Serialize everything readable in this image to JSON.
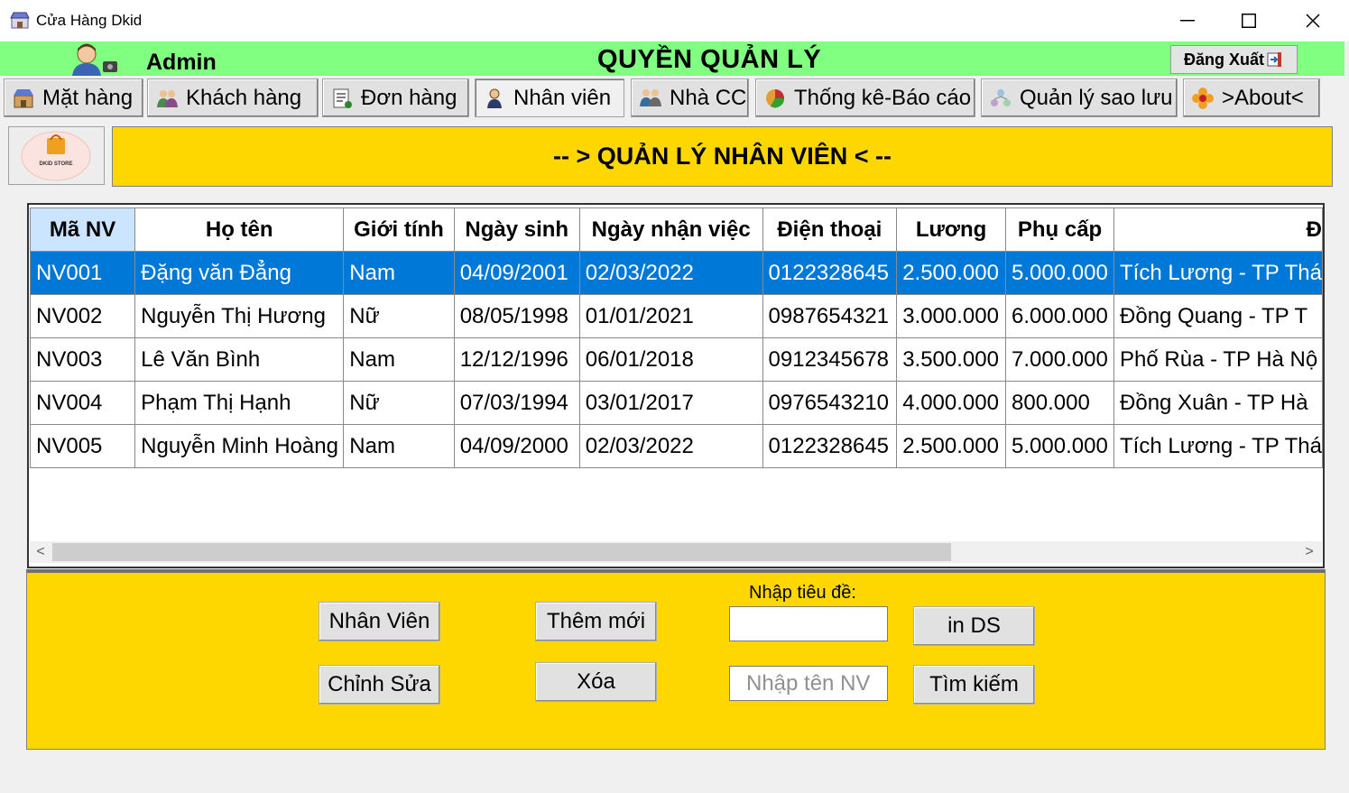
{
  "window": {
    "title": "Cửa Hàng Dkid",
    "minimize_glyph": "—",
    "maximize_glyph": "☐",
    "close_glyph": "✕"
  },
  "header": {
    "user_label": "Admin",
    "role_title": "QUYỀN QUẢN LÝ",
    "logout_label": "Đăng Xuất",
    "bg_color": "#80ff80"
  },
  "tabs": [
    {
      "label": "Mặt hàng",
      "icon": "store-icon"
    },
    {
      "label": "Khách hàng",
      "icon": "customers-icon"
    },
    {
      "label": "Đơn hàng",
      "icon": "orders-icon"
    },
    {
      "label": "Nhân viên",
      "icon": "employee-icon",
      "active": true
    },
    {
      "label": "Nhà CC",
      "icon": "supplier-icon"
    },
    {
      "label": "Thống kê-Báo cáo",
      "icon": "report-icon"
    },
    {
      "label": "Quản lý sao lưu",
      "icon": "backup-icon"
    },
    {
      "label": ">About<",
      "icon": "flower-icon"
    }
  ],
  "banner": {
    "title": "-- > QUẢN LÝ NHÂN VIÊN < --",
    "bg_color": "#ffd700",
    "logo_text": "DKID STORE"
  },
  "employees": {
    "columns": [
      "Mã NV",
      "Họ tên",
      "Giới tính",
      "Ngày sinh",
      "Ngày nhận việc",
      "Điện thoại",
      "Lương",
      "Phụ cấp",
      "Đ"
    ],
    "rows": [
      [
        "NV001",
        "Đặng văn Đẳng",
        "Nam",
        "04/09/2001",
        "02/03/2022",
        "0122328645",
        "2.500.000",
        "5.000.000",
        "Tích Lương - TP Thá"
      ],
      [
        "NV002",
        "Nguyễn Thị Hương",
        "Nữ",
        "08/05/1998",
        "01/01/2021",
        "0987654321",
        "3.000.000",
        "6.000.000",
        "Đồng Quang - TP T"
      ],
      [
        "NV003",
        "Lê Văn Bình",
        "Nam",
        "12/12/1996",
        "06/01/2018",
        "0912345678",
        "3.500.000",
        "7.000.000",
        "Phố Rùa - TP Hà Nộ"
      ],
      [
        "NV004",
        "Phạm Thị Hạnh",
        "Nữ",
        "07/03/1994",
        "03/01/2017",
        "0976543210",
        "4.000.000",
        "800.000",
        "Đồng Xuân - TP Hà"
      ],
      [
        "NV005",
        "Nguyễn Minh Hoàng",
        "Nam",
        "04/09/2000",
        "02/03/2022",
        "0122328645",
        "2.500.000",
        "5.000.000",
        "Tích Lương - TP Thá"
      ]
    ],
    "selected_row": 0,
    "scroll_left_glyph": "<",
    "scroll_right_glyph": ">"
  },
  "actions": {
    "employee_btn": "Nhân Viên",
    "add_btn": "Thêm mới",
    "edit_btn": "Chỉnh Sửa",
    "delete_btn": "Xóa",
    "title_label": "Nhập tiêu đề:",
    "title_value": "",
    "print_btn": "in DS",
    "search_placeholder": "Nhập tên NV",
    "search_btn": "Tìm kiếm"
  }
}
